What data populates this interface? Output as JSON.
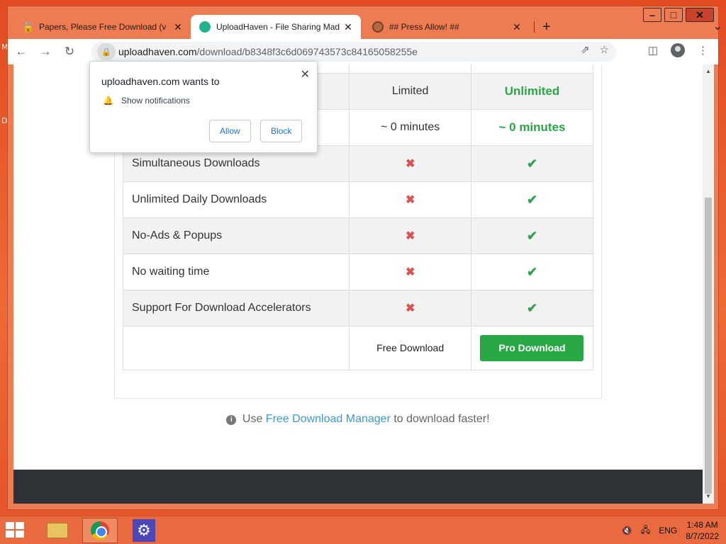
{
  "desktop": {
    "label_1": "M",
    "label_2": "D"
  },
  "tabs": [
    {
      "title": "Papers, Please Free Download (v",
      "icon": "lock-icon"
    },
    {
      "title": "UploadHaven - File Sharing Mad",
      "icon": "cloud-icon"
    },
    {
      "title": "## Press Allow! ##",
      "icon": "globe-icon"
    }
  ],
  "address_bar": {
    "host": "uploadhaven.com",
    "path": "/download/b8348f3c6d069743573c84165058255e"
  },
  "notification_popup": {
    "title": "uploadhaven.com wants to",
    "permission": "Show notifications",
    "allow_label": "Allow",
    "block_label": "Block"
  },
  "table": {
    "header": {
      "limited": "Limited",
      "unlimited": "Unlimited"
    },
    "wait_row": {
      "limited": "~ 0 minutes",
      "unlimited": "~ 0 minutes"
    },
    "features": [
      "Simultaneous Downloads",
      "Unlimited Daily Downloads",
      "No-Ads & Popups",
      "No waiting time",
      "Support For Download Accelerators"
    ],
    "free_download_label": "Free Download",
    "pro_download_label": "Pro Download"
  },
  "hint": {
    "prefix": "Use",
    "link": "Free Download Manager",
    "suffix": "to download faster!"
  },
  "taskbar": {
    "language": "ENG",
    "time": "1:48 AM",
    "date": "8/7/2022"
  },
  "colors": {
    "accent_green": "#28a745",
    "cross_red": "#d9534f",
    "link_blue": "#3c9ad6"
  }
}
